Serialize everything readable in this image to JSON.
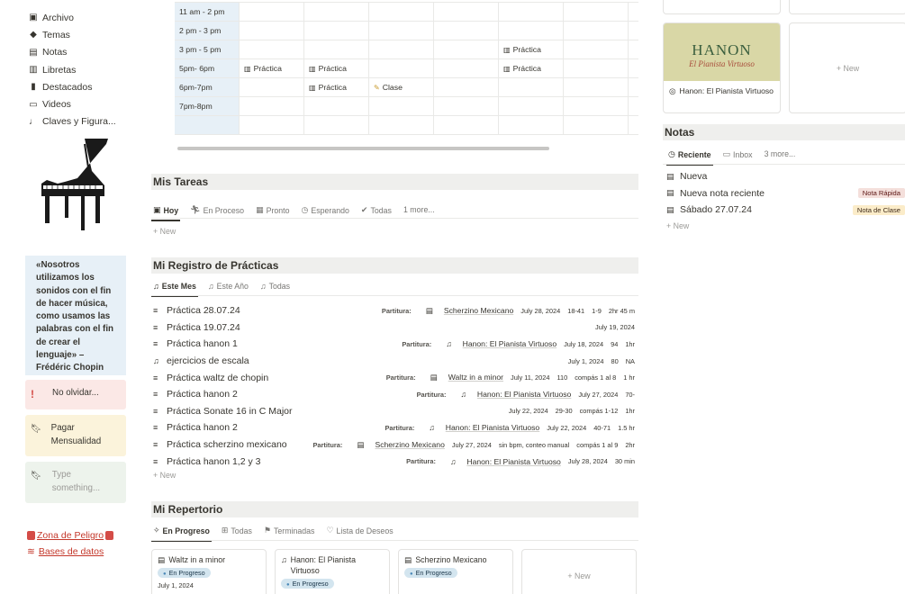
{
  "sidebar": {
    "items": [
      {
        "icon": "archive-icon",
        "glyph": "🗄",
        "label": "Archivo"
      },
      {
        "icon": "tag-icon",
        "glyph": "🏷",
        "label": "Temas"
      },
      {
        "icon": "note-icon",
        "glyph": "▤",
        "label": "Notas"
      },
      {
        "icon": "notebook-icon",
        "glyph": "▥",
        "label": "Libretas"
      },
      {
        "icon": "bookmark-icon",
        "glyph": "▮",
        "label": "Destacados"
      },
      {
        "icon": "video-icon",
        "glyph": "▭",
        "label": "Videos"
      },
      {
        "icon": "music-note-icon",
        "glyph": "♩",
        "label": "Claves y Figura..."
      }
    ],
    "quote": "«Nosotros utilizamos los sonidos con el fin de hacer música, como usamos las palabras con el fin de crear el lenguaje» – Frédéric Chopin",
    "callouts": {
      "alert": "No olvidar...",
      "payment": "Pagar Mensualidad",
      "placeholder": "Type something..."
    },
    "links": {
      "danger": "Zona de Peligro",
      "databases": "Bases de datos"
    }
  },
  "schedule": {
    "rows": [
      {
        "time": "11 am - 2 pm",
        "cells": [
          "",
          "",
          "",
          "",
          "",
          ""
        ]
      },
      {
        "time": "2 pm - 3 pm",
        "cells": [
          "",
          "",
          "",
          "",
          "",
          ""
        ]
      },
      {
        "time": "3 pm - 5 pm",
        "cells": [
          "",
          "",
          "",
          "",
          "Práctica",
          ""
        ]
      },
      {
        "time": "5pm- 6pm",
        "cells": [
          "Práctica",
          "Práctica",
          "",
          "",
          "Práctica",
          ""
        ]
      },
      {
        "time": "6pm-7pm",
        "cells": [
          "",
          "Práctica",
          "Clase",
          "",
          "",
          ""
        ]
      },
      {
        "time": "7pm-8pm",
        "cells": [
          "",
          "",
          "",
          "",
          "",
          ""
        ]
      },
      {
        "time": "",
        "cells": [
          "",
          "",
          "",
          "",
          "",
          ""
        ]
      }
    ]
  },
  "tareas": {
    "title": "Mis Tareas",
    "tabs": [
      "Hoy",
      "En Proceso",
      "Pronto",
      "Esperando",
      "Todas",
      "1 more..."
    ],
    "new_label": "New"
  },
  "registro": {
    "title": "Mi Registro de Prácticas",
    "tabs": [
      "Este Mes",
      "Este Año",
      "Todas"
    ],
    "partitura_label": "Partitura:",
    "new_label": "New",
    "rows": [
      {
        "name": "Práctica 28.07.24",
        "piece": "Scherzino Mexicano",
        "date": "July 28, 2024",
        "compas": "18-41",
        "tempo": "1-9",
        "duration": "2hr 45 m"
      },
      {
        "name": "Práctica 19.07.24",
        "piece": "",
        "date": "July 19, 2024",
        "compas": "",
        "tempo": "",
        "duration": ""
      },
      {
        "name": "Práctica hanon 1",
        "piece": "Hanon: El Pianista Virtuoso",
        "date": "July 18, 2024",
        "compas": "94",
        "tempo": "",
        "duration": "1hr"
      },
      {
        "name": "ejercicios de escala",
        "piece": "",
        "date": "July 1, 2024",
        "compas": "80",
        "tempo": "",
        "duration": "NA"
      },
      {
        "name": "Práctica waltz de chopin",
        "piece": "Waltz in a minor",
        "date": "July 11, 2024",
        "compas": "110",
        "tempo": "compás 1 al 8",
        "duration": "1 hr"
      },
      {
        "name": "Práctica hanon 2",
        "piece": "Hanon: El Pianista Virtuoso",
        "date": "July 27, 2024",
        "compas": "70-",
        "tempo": "",
        "duration": ""
      },
      {
        "name": "Práctica Sonate 16 in C Major",
        "piece": "",
        "date": "July 22, 2024",
        "compas": "29-30",
        "tempo": "compás 1-12",
        "duration": "1hr"
      },
      {
        "name": "Práctica hanon 2",
        "piece": "Hanon: El Pianista Virtuoso",
        "date": "July 22, 2024",
        "compas": "40-71",
        "tempo": "",
        "duration": "1.5 hr"
      },
      {
        "name": "Práctica scherzino mexicano",
        "piece": "Scherzino Mexicano",
        "date": "July 27, 2024",
        "compas": "sin bpm, conteo manual",
        "tempo": "compás 1 al 9",
        "duration": "2hr"
      },
      {
        "name": "Práctica hanon 1,2 y 3",
        "piece": "Hanon: El Pianista Virtuoso",
        "date": "July 28, 2024",
        "compas": "",
        "tempo": "",
        "duration": "30 min"
      }
    ]
  },
  "repertorio": {
    "title": "Mi Repertorio",
    "tabs": [
      "En Progreso",
      "Todas",
      "Terminadas",
      "Lista de Deseos"
    ],
    "cards": [
      {
        "title": "Waltz in a minor",
        "status": "En Progreso",
        "date": "July 1, 2024"
      },
      {
        "title": "Hanon: El Pianista Virtuoso",
        "status": "En Progreso",
        "date": ""
      },
      {
        "title": "Scherzino Mexicano",
        "status": "En Progreso",
        "date": ""
      }
    ],
    "new_label": "New"
  },
  "right": {
    "hanon_card": {
      "cover_title": "HANON",
      "cover_subtitle": "El Pianista Virtuoso",
      "caption": "Hanon: El Pianista Virtuoso"
    },
    "new_label": "New",
    "notas": {
      "title": "Notas",
      "tabs": [
        "Reciente",
        "Inbox",
        "3 more..."
      ],
      "items": [
        {
          "name": "Nueva",
          "tag": ""
        },
        {
          "name": "Nueva nota reciente",
          "tag": "Nota Rápida"
        },
        {
          "name": "Sábado 27.07.24",
          "tag": "Nota de Clase"
        }
      ],
      "new_label": "New"
    }
  }
}
